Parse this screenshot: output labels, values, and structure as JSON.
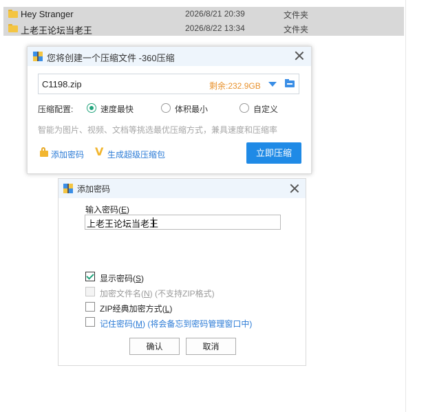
{
  "files": [
    {
      "name": "Hey Stranger",
      "date": "2026/8/21 20:39",
      "type": "文件夹"
    },
    {
      "name": "上老王论坛当老王",
      "date": "2026/8/22 13:34",
      "type": "文件夹"
    }
  ],
  "compress_dialog": {
    "title": "您将创建一个压缩文件 -360压缩",
    "filename": "C1198.zip",
    "free_space": "剩余:232.9GB",
    "config_label": "压缩配置:",
    "options": [
      "速度最快",
      "体积最小",
      "自定义"
    ],
    "selected_option": "速度最快",
    "hint": "智能为图片、视频、文档等挑选最优压缩方式，兼具速度和压缩率",
    "add_password": "添加密码",
    "super_zip": "生成超级压缩包",
    "compress_button": "立即压缩"
  },
  "password_dialog": {
    "title": "添加密码",
    "input_label": "输入密码(",
    "input_label_key": "E",
    "input_label_end": ")",
    "password_value": "上老王论坛当老王",
    "show_password": {
      "label": "显示密码(",
      "key": "S",
      "end": ")",
      "checked": true
    },
    "encrypt_filename": {
      "label": "加密文件名(",
      "key": "N",
      "end": ") (不支持ZIP格式)",
      "checked": false
    },
    "zip_classic": {
      "label": "ZIP经典加密方式(",
      "key": "L",
      "end": ")",
      "checked": false
    },
    "remember": {
      "label": "记住密码(",
      "key": "M",
      "end": ") (将会备忘到密码管理窗口中)",
      "checked": false
    },
    "ok_button": "确认",
    "cancel_button": "取消"
  },
  "colors": {
    "accent": "#1f8ae6",
    "green": "#22a47c",
    "orange": "#e8912c"
  }
}
